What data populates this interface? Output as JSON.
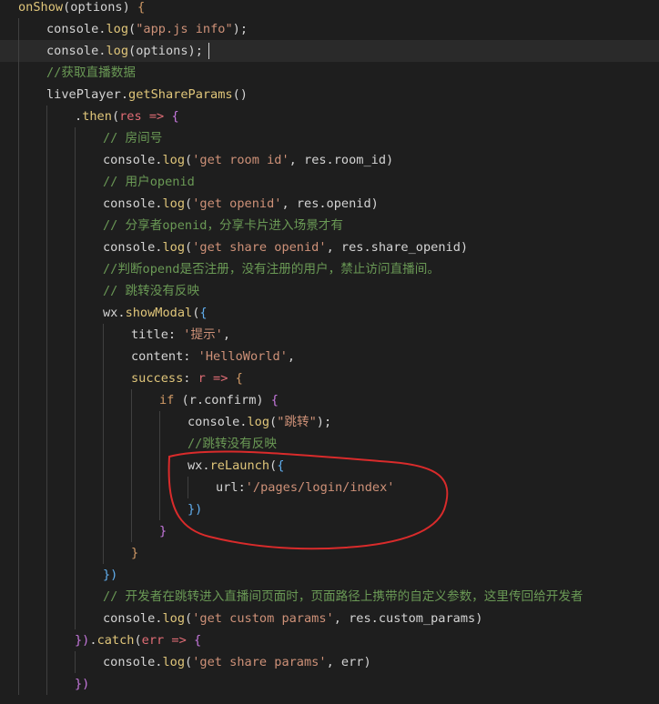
{
  "colors": {
    "background": "#1e1e1e",
    "current_line": "#2a2a2a",
    "annotation_stroke": "#d92b2b"
  },
  "lines": [
    {
      "indent": 0,
      "tokens": [
        [
          "fn",
          "onShow"
        ],
        [
          "punc",
          "(options) "
        ],
        [
          "brace",
          "{"
        ]
      ]
    },
    {
      "indent": 1,
      "tokens": [
        [
          "var",
          "console."
        ],
        [
          "fn",
          "log"
        ],
        [
          "punc",
          "("
        ],
        [
          "str",
          "\"app.js info\""
        ],
        [
          "punc",
          ");"
        ]
      ]
    },
    {
      "indent": 1,
      "current": true,
      "tokens": [
        [
          "var",
          "console."
        ],
        [
          "fn",
          "log"
        ],
        [
          "punc",
          "(options);"
        ]
      ]
    },
    {
      "indent": 1,
      "tokens": [
        [
          "cm",
          "//获取直播数据"
        ]
      ]
    },
    {
      "indent": 1,
      "tokens": [
        [
          "var",
          "livePlayer."
        ],
        [
          "fn",
          "getShareParams"
        ],
        [
          "punc",
          "()"
        ]
      ]
    },
    {
      "indent": 2,
      "tokens": [
        [
          "punc",
          "."
        ],
        [
          "fn",
          "then"
        ],
        [
          "punc",
          "("
        ],
        [
          "arrow",
          "res"
        ],
        [
          "punc",
          " "
        ],
        [
          "arrow",
          "=>"
        ],
        [
          "punc",
          " "
        ],
        [
          "brace2",
          "{"
        ]
      ]
    },
    {
      "indent": 3,
      "tokens": [
        [
          "cm",
          "// 房间号"
        ]
      ]
    },
    {
      "indent": 3,
      "tokens": [
        [
          "var",
          "console."
        ],
        [
          "fn",
          "log"
        ],
        [
          "punc",
          "("
        ],
        [
          "str",
          "'get room id'"
        ],
        [
          "punc",
          ", res.room_id)"
        ]
      ]
    },
    {
      "indent": 3,
      "tokens": [
        [
          "cm",
          "// 用户openid"
        ]
      ]
    },
    {
      "indent": 3,
      "tokens": [
        [
          "var",
          "console."
        ],
        [
          "fn",
          "log"
        ],
        [
          "punc",
          "("
        ],
        [
          "str",
          "'get openid'"
        ],
        [
          "punc",
          ", res.openid)"
        ]
      ]
    },
    {
      "indent": 3,
      "tokens": [
        [
          "cm",
          "// 分享者openid，分享卡片进入场景才有"
        ]
      ]
    },
    {
      "indent": 3,
      "tokens": [
        [
          "var",
          "console."
        ],
        [
          "fn",
          "log"
        ],
        [
          "punc",
          "("
        ],
        [
          "str",
          "'get share openid'"
        ],
        [
          "punc",
          ", res.share_openid)"
        ]
      ]
    },
    {
      "indent": 3,
      "tokens": [
        [
          "cm",
          "//判断opend是否注册，没有注册的用户，禁止访问直播间。"
        ]
      ]
    },
    {
      "indent": 3,
      "tokens": [
        [
          "cm",
          "// 跳转没有反映"
        ]
      ]
    },
    {
      "indent": 3,
      "tokens": [
        [
          "var",
          "wx."
        ],
        [
          "fn",
          "showModal"
        ],
        [
          "punc",
          "("
        ],
        [
          "brace3",
          "{"
        ]
      ]
    },
    {
      "indent": 4,
      "tokens": [
        [
          "prop",
          "title"
        ],
        [
          "punc",
          ": "
        ],
        [
          "str",
          "'提示'"
        ],
        [
          "punc",
          ","
        ]
      ]
    },
    {
      "indent": 4,
      "tokens": [
        [
          "prop",
          "content"
        ],
        [
          "punc",
          ": "
        ],
        [
          "str",
          "'HelloWorld'"
        ],
        [
          "punc",
          ","
        ]
      ]
    },
    {
      "indent": 4,
      "tokens": [
        [
          "fn",
          "success"
        ],
        [
          "punc",
          ": "
        ],
        [
          "arrow",
          "r"
        ],
        [
          "punc",
          " "
        ],
        [
          "arrow",
          "=>"
        ],
        [
          "punc",
          " "
        ],
        [
          "brace",
          "{"
        ]
      ]
    },
    {
      "indent": 5,
      "tokens": [
        [
          "kw",
          "if"
        ],
        [
          "punc",
          " (r.confirm) "
        ],
        [
          "brace2",
          "{"
        ]
      ]
    },
    {
      "indent": 6,
      "tokens": [
        [
          "var",
          "console."
        ],
        [
          "fn",
          "log"
        ],
        [
          "punc",
          "("
        ],
        [
          "str",
          "\"跳转\""
        ],
        [
          "punc",
          ");"
        ]
      ]
    },
    {
      "indent": 6,
      "tokens": [
        [
          "cm",
          "//跳转没有反映"
        ]
      ]
    },
    {
      "indent": 6,
      "tokens": [
        [
          "var",
          "wx."
        ],
        [
          "fn",
          "reLaunch"
        ],
        [
          "punc",
          "("
        ],
        [
          "brace3",
          "{"
        ]
      ]
    },
    {
      "indent": 7,
      "tokens": [
        [
          "prop",
          "url"
        ],
        [
          "punc",
          ":"
        ],
        [
          "str",
          "'/pages/login/index'"
        ]
      ]
    },
    {
      "indent": 6,
      "tokens": [
        [
          "brace3",
          "})"
        ]
      ]
    },
    {
      "indent": 5,
      "tokens": [
        [
          "brace2",
          "}"
        ]
      ]
    },
    {
      "indent": 4,
      "tokens": [
        [
          "brace",
          "}"
        ]
      ]
    },
    {
      "indent": 3,
      "tokens": [
        [
          "brace3",
          "})"
        ]
      ]
    },
    {
      "indent": 3,
      "tokens": [
        [
          "cm",
          "// 开发者在跳转进入直播间页面时，页面路径上携带的自定义参数，这里传回给开发者"
        ]
      ]
    },
    {
      "indent": 3,
      "tokens": [
        [
          "var",
          "console."
        ],
        [
          "fn",
          "log"
        ],
        [
          "punc",
          "("
        ],
        [
          "str",
          "'get custom params'"
        ],
        [
          "punc",
          ", res.custom_params)"
        ]
      ]
    },
    {
      "indent": 2,
      "tokens": [
        [
          "brace2",
          "})"
        ],
        [
          "punc",
          "."
        ],
        [
          "fn",
          "catch"
        ],
        [
          "punc",
          "("
        ],
        [
          "arrow",
          "err"
        ],
        [
          "punc",
          " "
        ],
        [
          "arrow",
          "=>"
        ],
        [
          "punc",
          " "
        ],
        [
          "brace2",
          "{"
        ]
      ]
    },
    {
      "indent": 3,
      "tokens": [
        [
          "var",
          "console."
        ],
        [
          "fn",
          "log"
        ],
        [
          "punc",
          "("
        ],
        [
          "str",
          "'get share params'"
        ],
        [
          "punc",
          ", err)"
        ]
      ]
    },
    {
      "indent": 2,
      "tokens": [
        [
          "brace2",
          "})"
        ]
      ]
    }
  ]
}
